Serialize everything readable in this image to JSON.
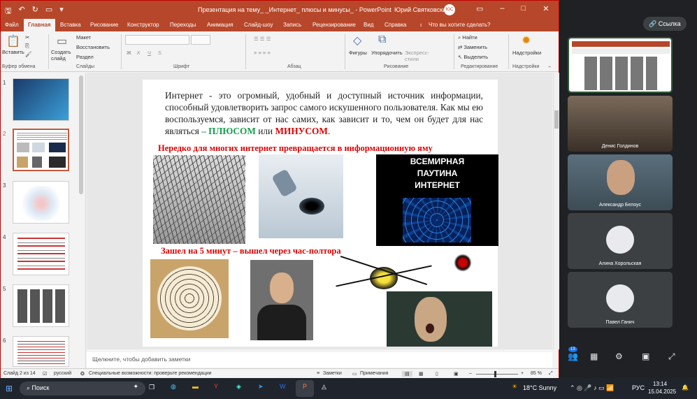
{
  "window": {
    "title": "Презентация на тему_ _Интернет_ плюсы и минусы_ - PowerPoint",
    "user": "Юрий Святковский",
    "avatar": "ЮС"
  },
  "tabs": [
    "Файл",
    "Главная",
    "Вставка",
    "Рисование",
    "Конструктор",
    "Переходы",
    "Анимация",
    "Слайд-шоу",
    "Запись",
    "Рецензирование",
    "Вид",
    "Справка",
    "Что вы хотите сделать?"
  ],
  "ribbon": {
    "paste": "Вставить",
    "clipboard_group": "Буфер обмена",
    "new_slide": "Создать слайд",
    "layout": "Макет",
    "reset": "Восстановить",
    "section": "Раздел",
    "slides_group": "Слайды",
    "font_group": "Шрифт",
    "paragraph_group": "Абзац",
    "shapes": "Фигуры",
    "arrange": "Упорядочить",
    "express_styles": "Экспресс-стили",
    "drawing_group": "Рисование",
    "find": "Найти",
    "replace": "Заменить",
    "select": "Выделить",
    "editing_group": "Редактирование",
    "addins": "Надстройки",
    "addins_group": "Надстройки"
  },
  "thumbnails": [
    "1",
    "2",
    "3",
    "4",
    "5",
    "6"
  ],
  "slide": {
    "paragraph_a": "Интернет - это огромный, удобный и доступный источник информации, способный удовлетворить запрос самого искушенного пользователя. Как мы ею воспользуемся, зависит от нас самих, как зависит и то, чем он будет для нас являться ",
    "plus": "– ПЛЮСОМ",
    "or": " или ",
    "minus": "МИНУСОМ",
    "dot": ".",
    "heading1": "Нередко для многих интернет превращается в информационную яму",
    "web_caption": "ВСЕМИРНАЯ ПАУТИНА ИНТЕРНЕТ",
    "heading2": "Зашел на 5 минут – вышел через час-полтора"
  },
  "notes_placeholder": "Щелкните, чтобы добавить заметки",
  "status": {
    "slide": "Слайд 2 из 14",
    "lang": "русский",
    "accessibility": "Специальные возможности: проверьте рекомендации",
    "notes": "Заметки",
    "comments": "Примечания",
    "zoom": "85 %"
  },
  "meet": {
    "link": "Ссылка",
    "participants": [
      "Денис Голдинов",
      "Александр Белоус",
      "Алина Хорольская",
      "Павел Ганич"
    ],
    "badge": "13"
  },
  "taskbar": {
    "search": "Поиск",
    "weather": "18°C  Sunny",
    "lang": "РУС",
    "time": "13:14",
    "date": "15.04.2025"
  },
  "colors": {
    "ppt_red": "#b7472a",
    "plus_green": "#15a04a",
    "minus_red": "#e00000"
  }
}
